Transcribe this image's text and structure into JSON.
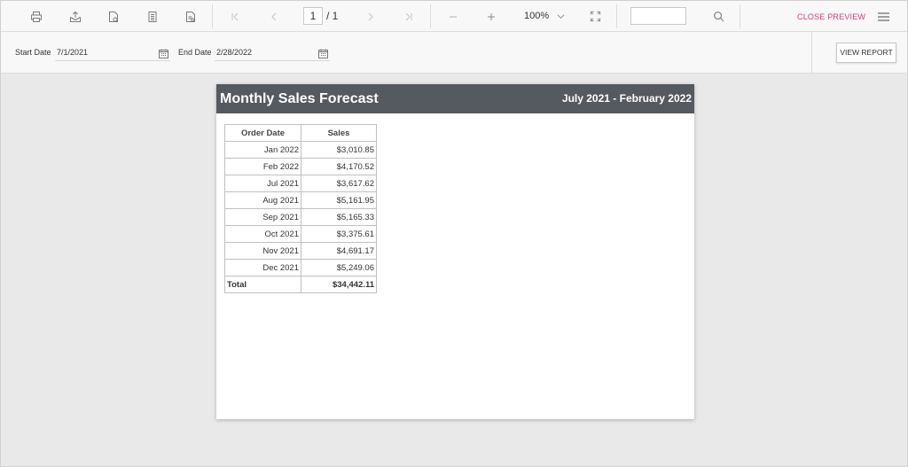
{
  "toolbar": {
    "icons": [
      "printer-icon",
      "export-icon",
      "page-setup-icon",
      "page-icon",
      "print-layout-icon",
      "first-page-icon",
      "previous-page-icon",
      "next-page-icon",
      "last-page-icon",
      "zoom-out-icon",
      "zoom-in-icon",
      "chevron-down-icon",
      "fit-page-icon",
      "search-icon",
      "hamburger-menu-icon"
    ],
    "current_page": "1",
    "page_total": "/ 1",
    "zoom": "100%",
    "close_preview": "CLOSE PREVIEW"
  },
  "params": {
    "start_label": "Start Date",
    "start_value": "7/1/2021",
    "end_label": "End Date",
    "end_value": "2/28/2022",
    "view_report": "VIEW REPORT"
  },
  "report": {
    "title": "Monthly Sales Forecast",
    "subtitle": "July 2021 - February 2022",
    "header_color": "#555960",
    "columns": [
      "Order Date",
      "Sales"
    ],
    "rows": [
      [
        "Jan 2022",
        "$3,010.85"
      ],
      [
        "Feb 2022",
        "$4,170.52"
      ],
      [
        "Jul 2021",
        "$3,617.62"
      ],
      [
        "Aug 2021",
        "$5,161.95"
      ],
      [
        "Sep 2021",
        "$5,165.33"
      ],
      [
        "Oct 2021",
        "$3,375.61"
      ],
      [
        "Nov 2021",
        "$4,691.17"
      ],
      [
        "Dec 2021",
        "$5,249.06"
      ]
    ],
    "total_label": "Total",
    "total_value": "$34,442.11"
  },
  "colors": {
    "accent": "#e3386d",
    "icon_active": "#7a7a7a",
    "icon_disabled": "#c4c4c4"
  }
}
